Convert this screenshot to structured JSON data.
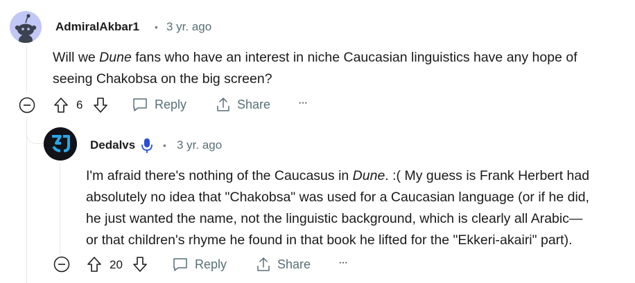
{
  "comments": [
    {
      "username": "AdmiralAkbar1",
      "separator": "•",
      "time": "3 yr. ago",
      "body_line1_pre": "Will we ",
      "body_line1_em": "Dune",
      "body_line1_post": " fans who have an interest in niche Caucasian linguistics have any hope of",
      "body_line2": "seeing Chakobsa on the big screen?",
      "score": "6",
      "reply_label": "Reply",
      "share_label": "Share",
      "more_label": "···",
      "avatar_icon": "reddit-snoo-icon"
    },
    {
      "username": "Dedalvs",
      "separator": "•",
      "time": "3 yr. ago",
      "flair_icon": "microphone-icon",
      "body_line1_pre": "I'm afraid there's nothing of the Caucasus in ",
      "body_line1_em": "Dune",
      "body_line1_post": ". :( My guess is Frank Herbert had",
      "body_line2": "absolutely no idea that \"Chakobsa\" was used for a Caucasian language (or if he did,",
      "body_line3": "he just wanted the name, not the linguistic background, which is clearly all Arabic—",
      "body_line4": "or that children's rhyme he found in that book he lifted for the \"Ekkeri-akairi\" part).",
      "score": "20",
      "reply_label": "Reply",
      "share_label": "Share",
      "more_label": "···",
      "avatar_icon": "dedalvs-logo-icon"
    }
  ],
  "colors": {
    "text": "#1a1a1b",
    "meta": "#576f76",
    "thread_line": "#e5e7e9",
    "snoo_bg": "#c2c8f5",
    "logo_blue": "#2aa6e8",
    "mic_blue": "#2a4fd1"
  }
}
